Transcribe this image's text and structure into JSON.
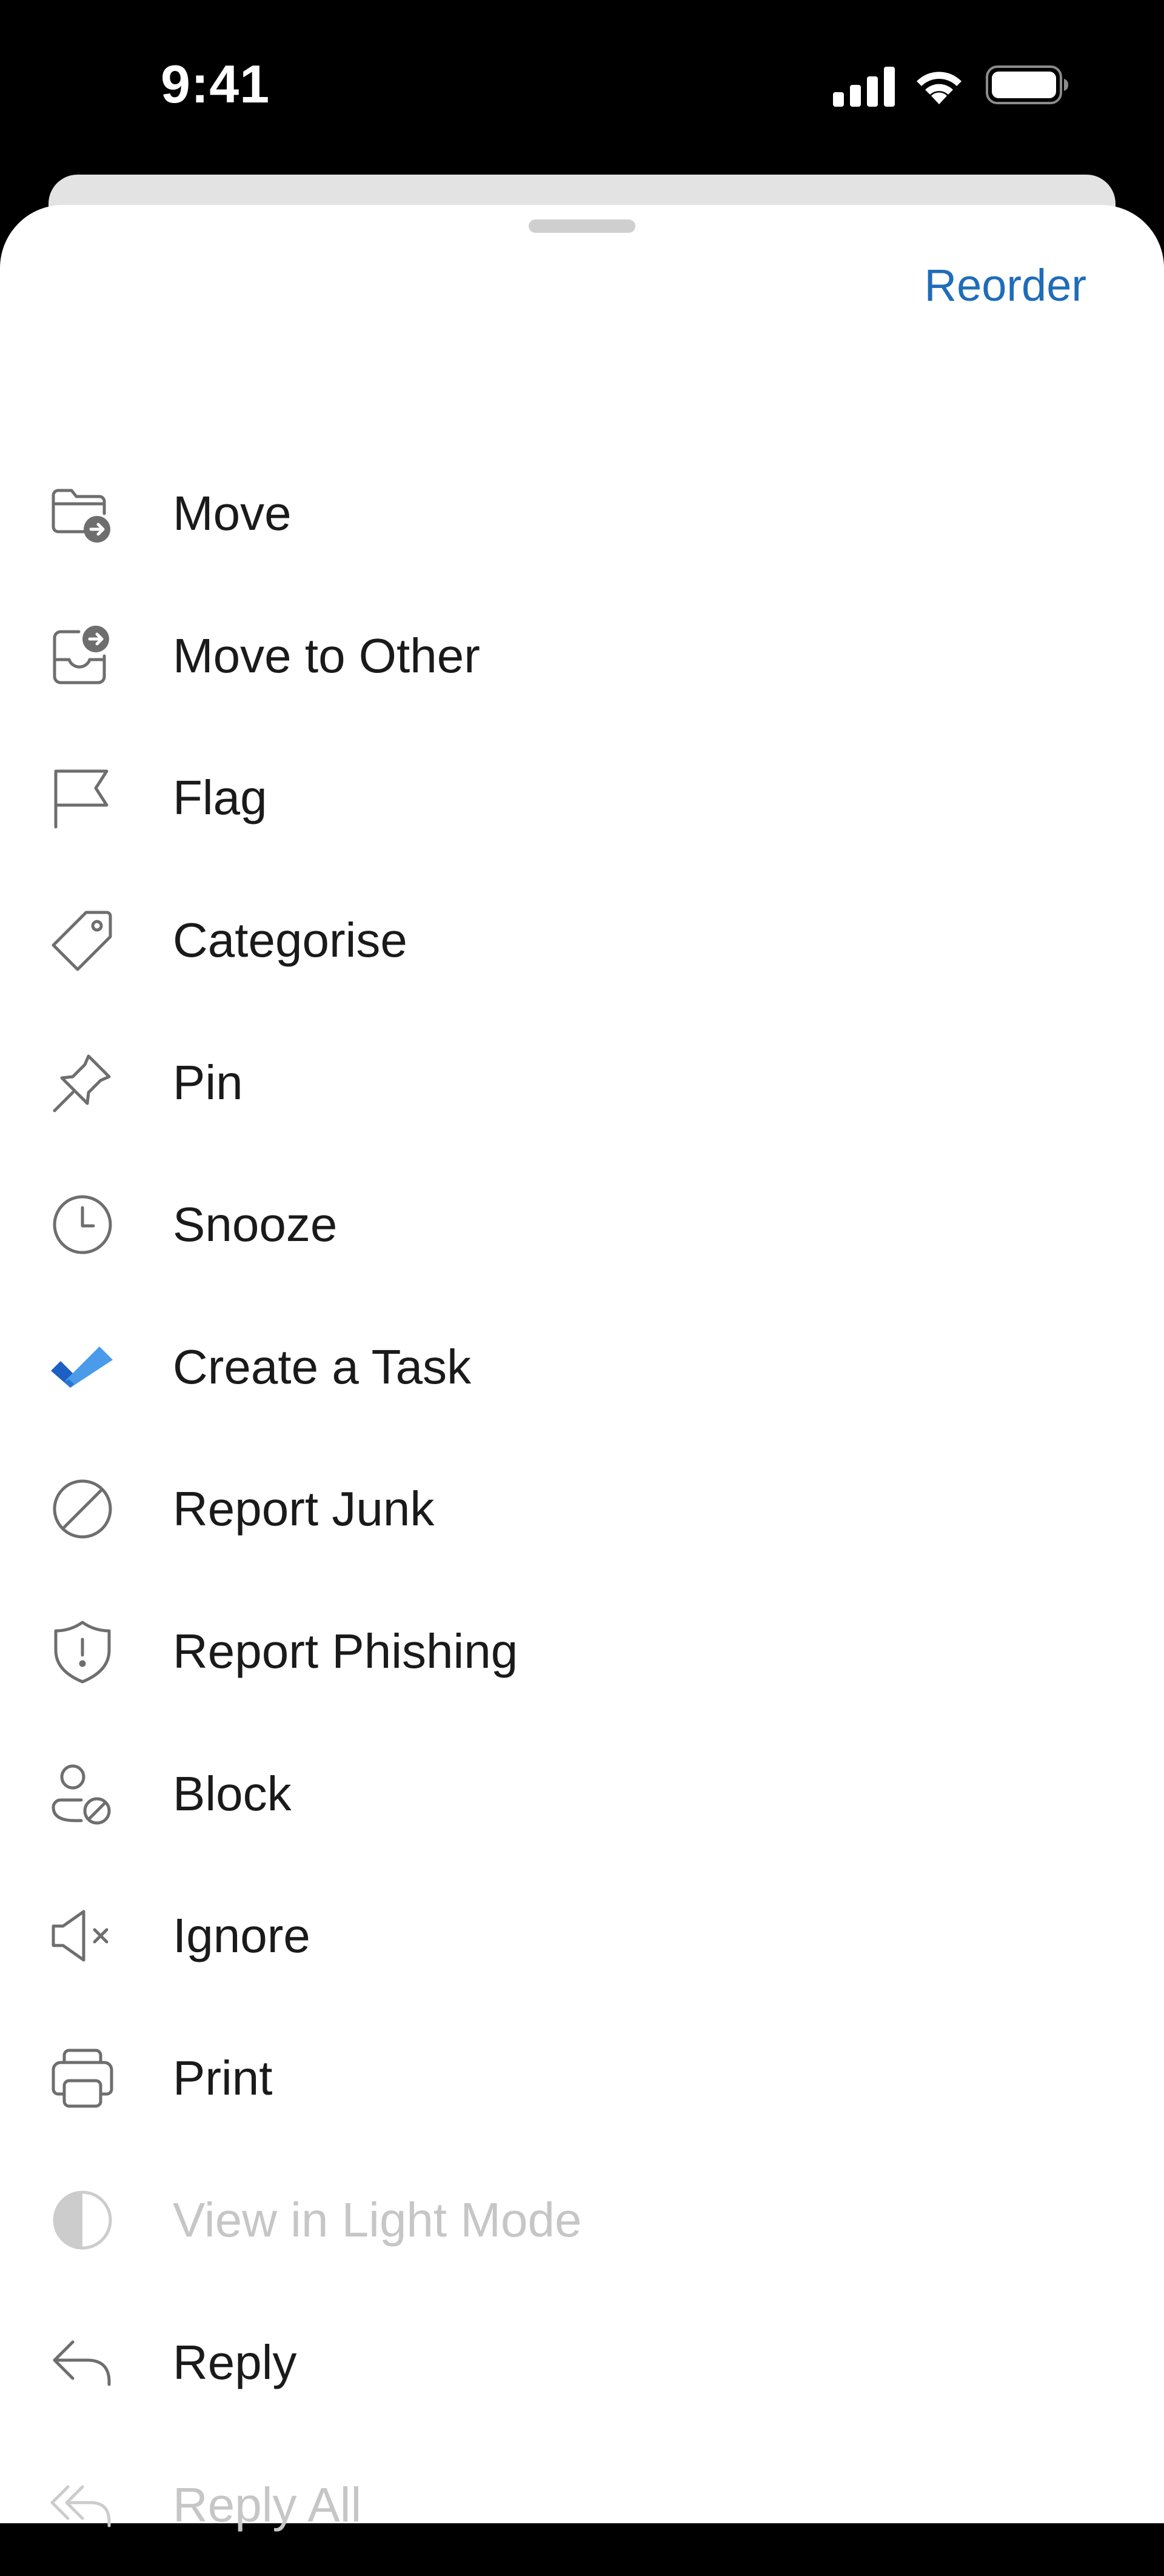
{
  "status_bar": {
    "time": "9:41",
    "icons": [
      "cellular-signal-icon",
      "wifi-icon",
      "battery-icon"
    ]
  },
  "sheet": {
    "reorder_label": "Reorder",
    "accent_color": "#1f6cb8",
    "items": [
      {
        "label": "Move",
        "icon": "folder-move-icon",
        "disabled": false
      },
      {
        "label": "Move to Other",
        "icon": "inbox-move-icon",
        "disabled": false
      },
      {
        "label": "Flag",
        "icon": "flag-icon",
        "disabled": false
      },
      {
        "label": "Categorise",
        "icon": "tag-icon",
        "disabled": false
      },
      {
        "label": "Pin",
        "icon": "pin-icon",
        "disabled": false
      },
      {
        "label": "Snooze",
        "icon": "clock-icon",
        "disabled": false
      },
      {
        "label": "Create a Task",
        "icon": "todo-check-icon",
        "disabled": false
      },
      {
        "label": "Report Junk",
        "icon": "prohibited-icon",
        "disabled": false
      },
      {
        "label": "Report Phishing",
        "icon": "shield-alert-icon",
        "disabled": false
      },
      {
        "label": "Block",
        "icon": "person-block-icon",
        "disabled": false
      },
      {
        "label": "Ignore",
        "icon": "speaker-mute-icon",
        "disabled": false
      },
      {
        "label": "Print",
        "icon": "printer-icon",
        "disabled": false
      },
      {
        "label": "View in Light Mode",
        "icon": "contrast-icon",
        "disabled": true
      },
      {
        "label": "Reply",
        "icon": "reply-icon",
        "disabled": false
      },
      {
        "label": "Reply All",
        "icon": "reply-all-icon",
        "disabled": true
      }
    ]
  }
}
